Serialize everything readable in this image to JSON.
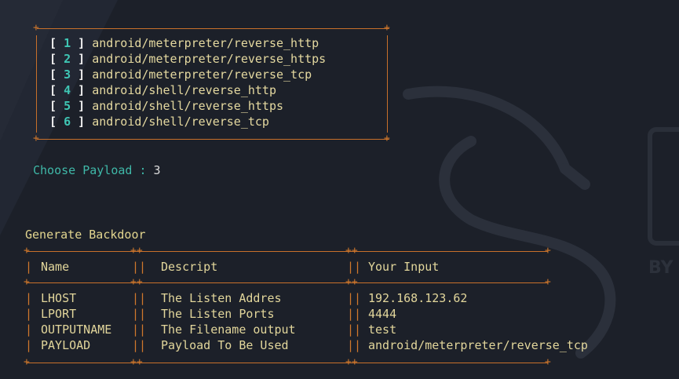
{
  "menu": {
    "items": [
      {
        "num": "1",
        "label": "android/meterpreter/reverse_http"
      },
      {
        "num": "2",
        "label": "android/meterpreter/reverse_https"
      },
      {
        "num": "3",
        "label": "android/meterpreter/reverse_tcp"
      },
      {
        "num": "4",
        "label": "android/shell/reverse_http"
      },
      {
        "num": "5",
        "label": "android/shell/reverse_https"
      },
      {
        "num": "6",
        "label": "android/shell/reverse_tcp"
      }
    ]
  },
  "prompt": {
    "label": "Choose Payload : ",
    "value": "3"
  },
  "backdoor": {
    "title": "Generate Backdoor",
    "headers": [
      "Name",
      "Descript",
      "Your Input"
    ],
    "rows": [
      [
        "LHOST",
        "The Listen Addres",
        "192.168.123.62"
      ],
      [
        "LPORT",
        "The Listen Ports",
        "4444"
      ],
      [
        "OUTPUTNAME",
        "The Filename output",
        "test"
      ],
      [
        "PAYLOAD",
        "Payload To Be Used",
        "android/meterpreter/reverse_tcp"
      ]
    ]
  },
  "watermark": {
    "text": "BY"
  },
  "colors": {
    "background": "#1c2029",
    "border": "#d0782c",
    "accent_teal": "#3fc6b4",
    "text_yellow": "#e2d69b"
  }
}
